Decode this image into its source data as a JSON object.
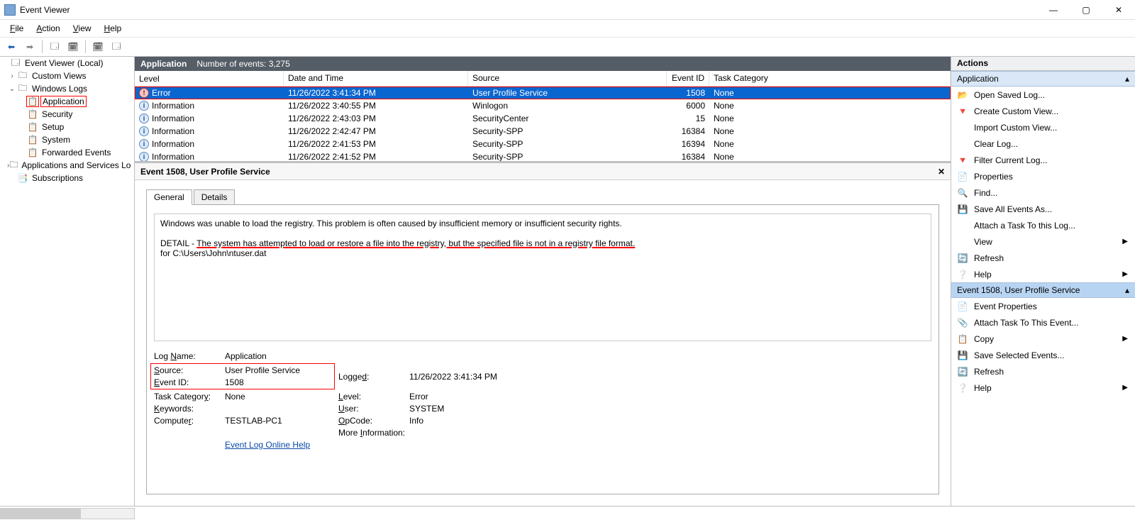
{
  "window": {
    "title": "Event Viewer"
  },
  "menu": {
    "file": "File",
    "action": "Action",
    "view": "View",
    "help": "Help"
  },
  "tree": {
    "root": "Event Viewer (Local)",
    "custom": "Custom Views",
    "winlogs": "Windows Logs",
    "app": "Application",
    "security": "Security",
    "setup": "Setup",
    "system": "System",
    "forwarded": "Forwarded Events",
    "appsvc": "Applications and Services Lo",
    "subs": "Subscriptions"
  },
  "center": {
    "header_title": "Application",
    "header_count": "Number of events: 3,275",
    "cols": {
      "level": "Level",
      "dt": "Date and Time",
      "src": "Source",
      "id": "Event ID",
      "tc": "Task Category"
    },
    "rows": [
      {
        "level": "Error",
        "icon": "err",
        "dt": "11/26/2022 3:41:34 PM",
        "src": "User Profile Service",
        "id": "1508",
        "tc": "None",
        "sel": true
      },
      {
        "level": "Information",
        "icon": "info",
        "dt": "11/26/2022 3:40:55 PM",
        "src": "Winlogon",
        "id": "6000",
        "tc": "None"
      },
      {
        "level": "Information",
        "icon": "info",
        "dt": "11/26/2022 2:43:03 PM",
        "src": "SecurityCenter",
        "id": "15",
        "tc": "None"
      },
      {
        "level": "Information",
        "icon": "info",
        "dt": "11/26/2022 2:42:47 PM",
        "src": "Security-SPP",
        "id": "16384",
        "tc": "None"
      },
      {
        "level": "Information",
        "icon": "info",
        "dt": "11/26/2022 2:41:53 PM",
        "src": "Security-SPP",
        "id": "16394",
        "tc": "None"
      },
      {
        "level": "Information",
        "icon": "info",
        "dt": "11/26/2022 2:41:52 PM",
        "src": "Security-SPP",
        "id": "16384",
        "tc": "None"
      }
    ]
  },
  "detail": {
    "title": "Event 1508, User Profile Service",
    "tab_general": "General",
    "tab_details": "Details",
    "msg1": "Windows was unable to load the registry. This problem is often caused by insufficient memory or insufficient security rights.",
    "msg2a": "DETAIL - ",
    "msg2b": "The system has attempted to load or restore a file into the registry, but the specified file is not in a registry file format.",
    "msg3": "for C:\\Users\\John\\ntuser.dat",
    "labels": {
      "logname": "Log Name:",
      "source": "Source:",
      "eventid": "Event ID:",
      "level": "Level:",
      "user": "User:",
      "opcode": "OpCode:",
      "more": "More Information:",
      "logged": "Logged:",
      "taskcat": "Task Category:",
      "keywords": "Keywords:",
      "computer": "Computer:"
    },
    "values": {
      "logname": "Application",
      "source": "User Profile Service",
      "eventid": "1508",
      "level": "Error",
      "user": "SYSTEM",
      "opcode": "Info",
      "logged": "11/26/2022 3:41:34 PM",
      "taskcat": "None",
      "keywords": "",
      "computer": "TESTLAB-PC1",
      "morelink": "Event Log Online Help"
    }
  },
  "actions": {
    "header": "Actions",
    "sec1_title": "Application",
    "sec1": [
      {
        "icon": "📂",
        "label": "Open Saved Log..."
      },
      {
        "icon": "🔻",
        "label": "Create Custom View..."
      },
      {
        "icon": "",
        "label": "Import Custom View..."
      },
      {
        "icon": "",
        "label": "Clear Log..."
      },
      {
        "icon": "🔻",
        "label": "Filter Current Log..."
      },
      {
        "icon": "📄",
        "label": "Properties"
      },
      {
        "icon": "🔍",
        "label": "Find..."
      },
      {
        "icon": "💾",
        "label": "Save All Events As..."
      },
      {
        "icon": "",
        "label": "Attach a Task To this Log..."
      },
      {
        "icon": "",
        "label": "View",
        "arrow": true
      },
      {
        "icon": "🔄",
        "label": "Refresh"
      },
      {
        "icon": "❔",
        "label": "Help",
        "arrow": true
      }
    ],
    "sec2_title": "Event 1508, User Profile Service",
    "sec2": [
      {
        "icon": "📄",
        "label": "Event Properties"
      },
      {
        "icon": "📎",
        "label": "Attach Task To This Event..."
      },
      {
        "icon": "📋",
        "label": "Copy",
        "arrow": true
      },
      {
        "icon": "💾",
        "label": "Save Selected Events..."
      },
      {
        "icon": "🔄",
        "label": "Refresh"
      },
      {
        "icon": "❔",
        "label": "Help",
        "arrow": true
      }
    ]
  }
}
